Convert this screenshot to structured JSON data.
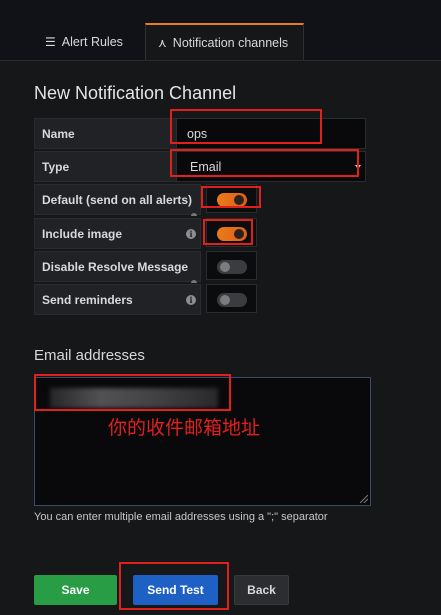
{
  "tabs": [
    {
      "label": "Alert Rules",
      "icon": "list-icon",
      "active": false
    },
    {
      "label": "Notification channels",
      "icon": "notification-channel-icon",
      "active": true
    }
  ],
  "page_title": "New Notification Channel",
  "form": {
    "name": {
      "label": "Name",
      "value": "ops"
    },
    "type": {
      "label": "Type",
      "value": "Email"
    },
    "toggles": [
      {
        "label": "Default (send on all alerts)",
        "on": true,
        "info": false
      },
      {
        "label": "Include image",
        "on": true,
        "info": true
      },
      {
        "label": "Disable Resolve Message",
        "on": false,
        "info": false
      },
      {
        "label": "Send reminders",
        "on": false,
        "info": true
      }
    ]
  },
  "email": {
    "section_title": "Email addresses",
    "annotation": "你的收件邮箱地址",
    "helper": "You can enter multiple email addresses using a \";\" separator"
  },
  "buttons": {
    "save": "Save",
    "send_test": "Send Test",
    "back": "Back"
  },
  "colors": {
    "accent": "#eb7b18",
    "annotation_red": "#e0201d",
    "save_green": "#299c46",
    "primary_blue": "#1f60c4"
  }
}
